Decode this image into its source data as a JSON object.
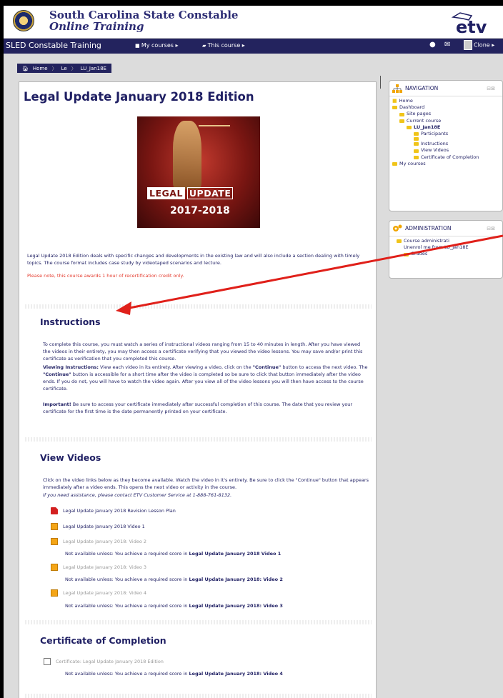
{
  "header": {
    "title_line1": "South Carolina State Constable",
    "title_line2": "Online Training",
    "brand_logo": "etv"
  },
  "navbar": {
    "site_name": "SLED Constable Training",
    "my_courses": "My courses ▸",
    "this_course": "This course ▸",
    "user": "Clone ▸"
  },
  "breadcrumb": [
    "Home",
    "Le",
    "LU_Jan18E"
  ],
  "course": {
    "title": "Legal Update January 2018 Edition",
    "image_text_1": "LEGAL",
    "image_text_2": "UPDATE",
    "image_text_3": "2017-2018",
    "summary": "Legal Update 2018 Edition deals with specific changes and developments in the existing law and will also include a section dealing with timely topics. The course format includes case study by videotaped scenarios and lecture.",
    "credit_note": "Please note, this course awards 1 hour of recertification credit only."
  },
  "instructions": {
    "title": "Instructions",
    "p1": "To complete this course, you must watch a series of instructional videos ranging from 15 to 40 minutes in length. After you have viewed the videos in their entirety, you may then access a certificate verifying that you viewed the video lessons. You may save and/or print this certificate as verification that you completed this course.",
    "p2_label": "Viewing Instructions:",
    "p2_a": " View each video in its entirety. After viewing a video, click on the ",
    "p2_continue": "\"Continue\"",
    "p2_b": " button to access the next video. The ",
    "p2_c": " button is accessible for a short time after the video is completed so be sure to click that button immediately after the video ends. If you do not, you will have to watch the video again. After you view all of the video lessons you will then have access to the course certificate.",
    "p3_label": "Important!",
    "p3": " Be sure to access your certificate immediately after successful completion of this course. The date that you review your certificate for the first time is the date permanently printed on your certificate."
  },
  "videos": {
    "title": "View Videos",
    "p1": "Click on the video links below as they become available. Watch the video in it's entirety. Be sure to click the \"Continue\" button that appears immediately after a video ends. This opens the next video or activity in the course.",
    "p2": "If you need assistance, please contact ETV Customer Service at 1-888-761-8132.",
    "items": [
      {
        "label": "Legal Update January 2018 Revision Lesson Plan",
        "icon": "pdf-icon"
      },
      {
        "label": "Legal Update January 2018 Video 1",
        "icon": "video-icon"
      },
      {
        "label": "Legal Update January 2018: Video 2",
        "icon": "video-icon"
      },
      {
        "label": "Legal Update January 2018: Video 3",
        "icon": "video-icon"
      },
      {
        "label": "Legal Update January 2018: Video 4",
        "icon": "video-icon"
      }
    ],
    "restrict_prefix": "Not available unless: You achieve a required score in ",
    "restrict_1": "Legal Update January 2018 Video 1",
    "restrict_2": "Legal Update January 2018: Video 2",
    "restrict_3": "Legal Update January 2018: Video 3"
  },
  "certificate": {
    "title": "Certificate of Completion",
    "item": "Certificate: Legal Update January 2018 Edition",
    "restrict": "Legal Update January 2018: Video 4"
  },
  "navigation_block": {
    "title": "NAVIGATION",
    "items": [
      "Home",
      "Dashboard",
      "Site pages",
      "Current course",
      "LU_Jan18E",
      "Participants",
      "",
      "Instructions",
      "View Videos",
      "Certificate of Completion",
      "My courses"
    ]
  },
  "admin_block": {
    "title": "ADMINISTRATION",
    "items": [
      "Course administrati",
      "Unenrol me from LU_Jan18E",
      "Grades"
    ]
  },
  "colors": {
    "navy": "#23235e",
    "text": "#1f1f63",
    "red_note": "#e43b2e",
    "folder": "#f0c419"
  }
}
